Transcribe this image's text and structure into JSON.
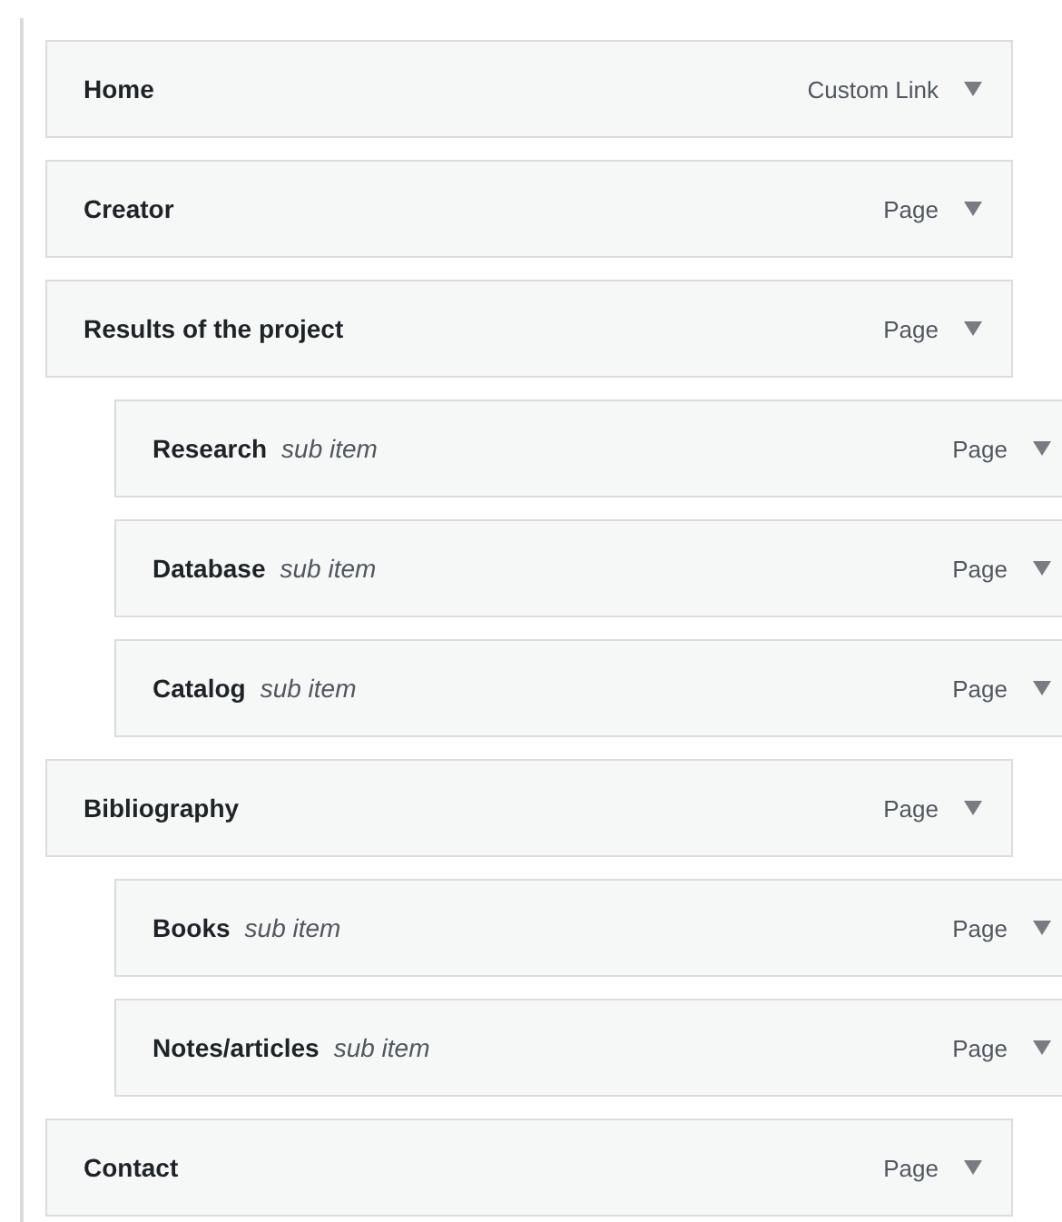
{
  "menu_items": [
    {
      "title": "Home",
      "type": "Custom Link"
    },
    {
      "title": "Creator",
      "type": "Page"
    },
    {
      "title": "Results of the project",
      "type": "Page",
      "children": [
        {
          "title": "Research",
          "note": "sub item",
          "type": "Page"
        },
        {
          "title": "Database",
          "note": "sub item",
          "type": "Page"
        },
        {
          "title": "Catalog",
          "note": "sub item",
          "type": "Page"
        }
      ]
    },
    {
      "title": "Bibliography",
      "type": "Page",
      "children": [
        {
          "title": "Books",
          "note": "sub item",
          "type": "Page"
        },
        {
          "title": "Notes/articles",
          "note": "sub item",
          "type": "Page"
        }
      ]
    },
    {
      "title": "Contact",
      "type": "Page"
    }
  ]
}
